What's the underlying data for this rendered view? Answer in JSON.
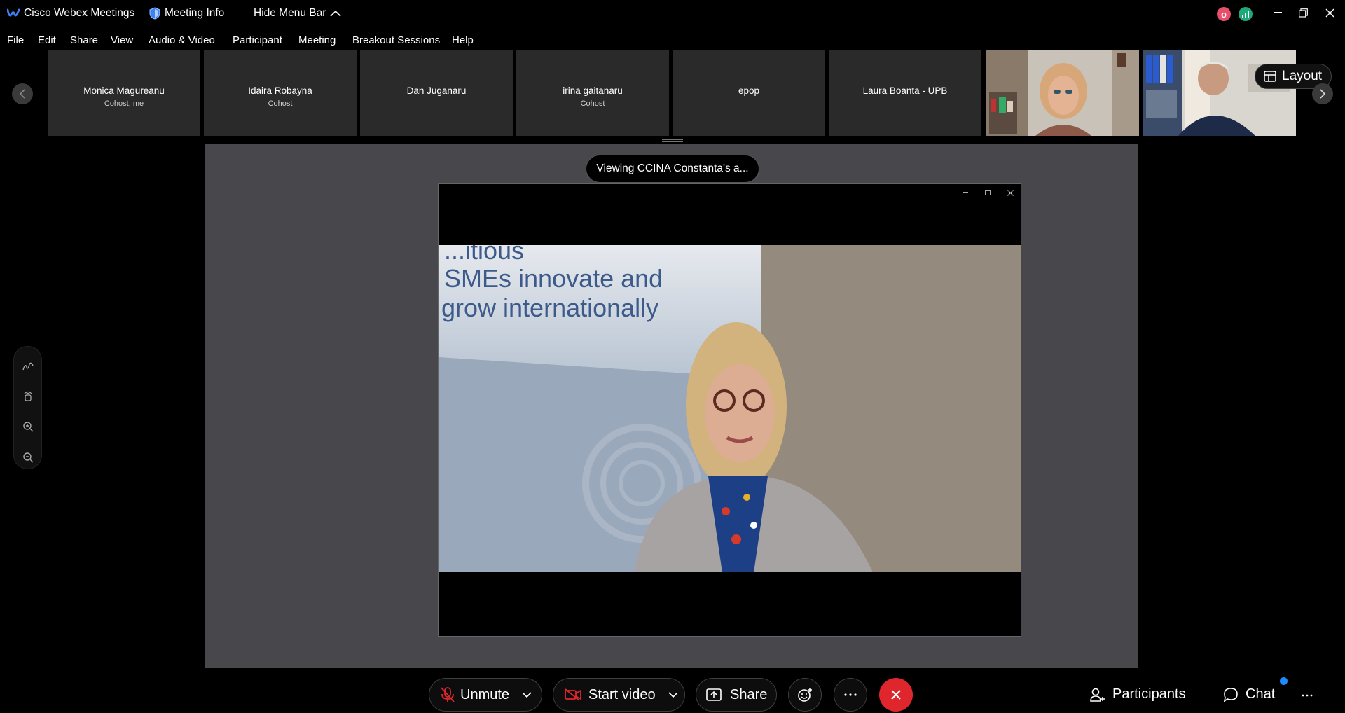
{
  "titlebar": {
    "app_name": "Cisco Webex Meetings",
    "meeting_info": "Meeting Info",
    "hide_menu": "Hide Menu Bar",
    "badge_letter": "o"
  },
  "menu": [
    "File",
    "Edit",
    "Share",
    "View",
    "Audio & Video",
    "Participant",
    "Meeting",
    "Breakout Sessions",
    "Help"
  ],
  "participants": [
    {
      "name": "Monica Magureanu",
      "role": "Cohost, me"
    },
    {
      "name": "Idaira Robayna",
      "role": "Cohost"
    },
    {
      "name": "Dan Juganaru",
      "role": ""
    },
    {
      "name": "irina gaitanaru",
      "role": "Cohost"
    },
    {
      "name": "epop",
      "role": ""
    },
    {
      "name": "Laura Boanta - UPB",
      "role": ""
    }
  ],
  "layout_label": "Layout",
  "viewing_label": "Viewing CCINA Constanta's a...",
  "banner": {
    "line0": "...itious",
    "line1": "SMEs innovate and",
    "line2": "grow internationally"
  },
  "controls": {
    "unmute": "Unmute",
    "start_video": "Start video",
    "share": "Share",
    "participants": "Participants",
    "chat": "Chat"
  },
  "colors": {
    "end_call": "#e0262d",
    "notification": "#1a8cff",
    "webex_blue": "#3b82f6",
    "badge_pink": "#e84f6b",
    "badge_green": "#1fa87a"
  }
}
